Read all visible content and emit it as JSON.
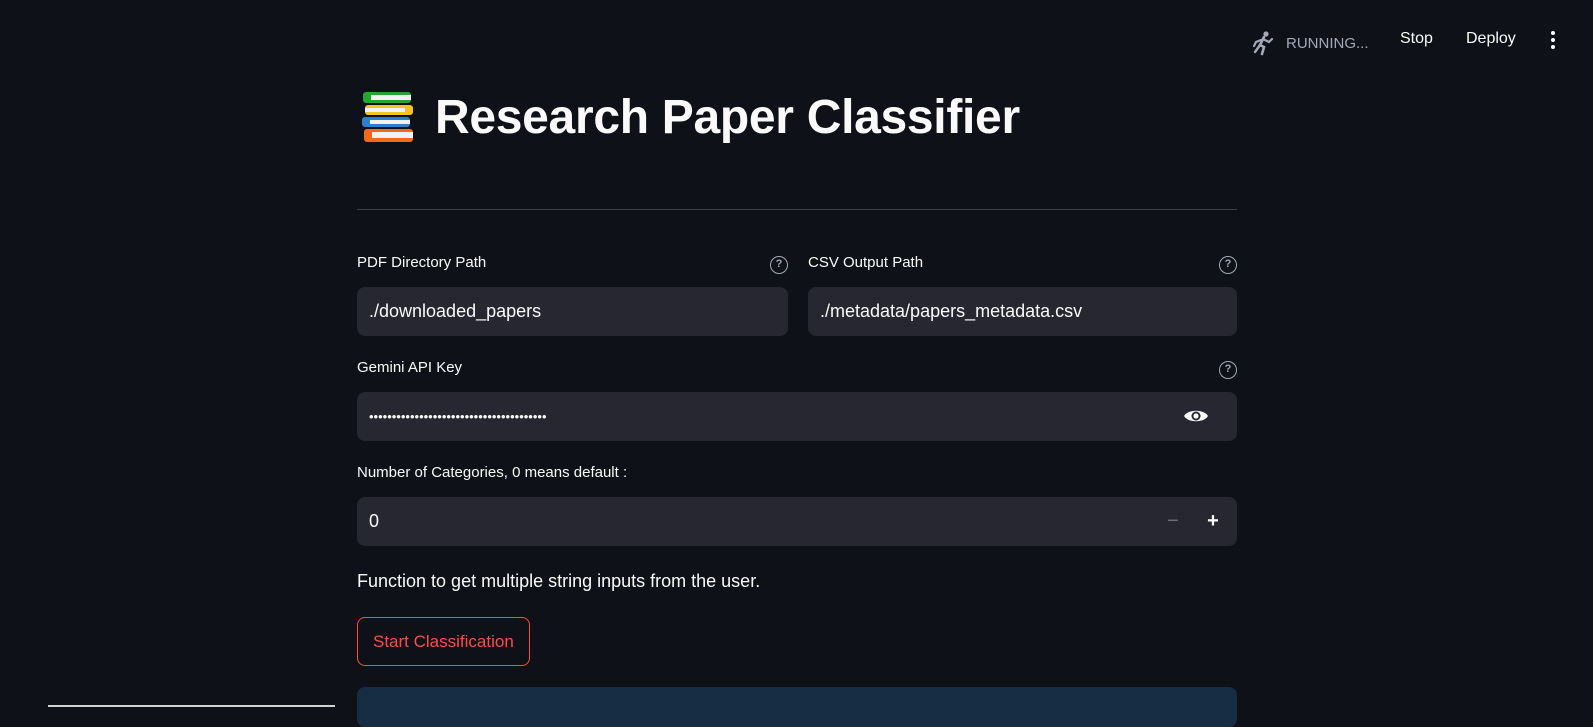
{
  "header": {
    "status_text": "RUNNING...",
    "stop_label": "Stop",
    "deploy_label": "Deploy",
    "status_icon": "running-man-icon",
    "menu_icon": "kebab-menu-icon"
  },
  "page": {
    "title": "Research Paper Classifier",
    "title_icon": "books-icon"
  },
  "form": {
    "pdf_dir": {
      "label": "PDF Directory Path",
      "value": "./downloaded_papers"
    },
    "csv_out": {
      "label": "CSV Output Path",
      "value": "./metadata/papers_metadata.csv"
    },
    "api_key": {
      "label": "Gemini API Key",
      "value": "•••••••••••••••••••••••••••••••••••••••"
    },
    "num_categories": {
      "label": "Number of Categories, 0 means default :",
      "value": "0",
      "minus": "−",
      "plus": "+"
    },
    "description": "Function to get multiple string inputs from the user.",
    "start_label": "Start Classification"
  },
  "colors": {
    "background": "#0e1117",
    "input_bg": "#262730",
    "accent": "#ff4b4b",
    "info_bg": "#172d43"
  }
}
